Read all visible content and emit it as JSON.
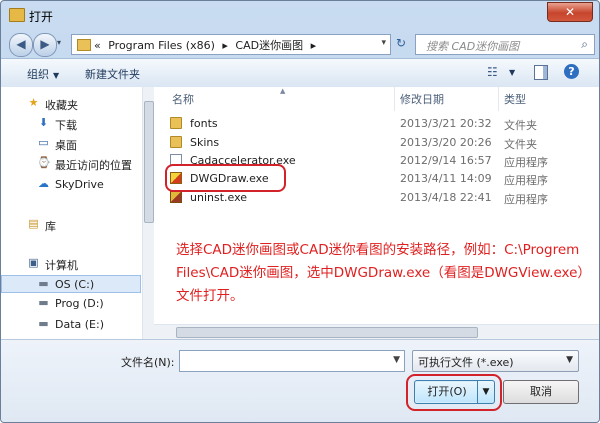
{
  "window": {
    "title": "打开",
    "close_glyph": "✕"
  },
  "address": {
    "back_glyph": "◀",
    "forward_glyph": "▶",
    "drop_glyph": "▾",
    "root_glyph": "«",
    "crumbs": [
      "Program Files (x86)",
      "▸",
      "CAD迷你画图",
      "▸"
    ],
    "refresh_glyph": "↻"
  },
  "search": {
    "placeholder": "搜索 CAD迷你画图",
    "icon": "search-icon",
    "glyph": "⌕"
  },
  "toolbar": {
    "organize": "组织",
    "new_folder": "新建文件夹",
    "arrow": "▼",
    "view_glyph": "☷",
    "help": "?"
  },
  "sidebar": {
    "items": [
      {
        "label": "收藏夹",
        "glyph": "★",
        "icon": "star-icon"
      },
      {
        "label": "下载",
        "glyph": "⬇",
        "icon": "download-icon"
      },
      {
        "label": "桌面",
        "glyph": "▭",
        "icon": "desktop-icon"
      },
      {
        "label": "最近访问的位置",
        "glyph": "⌚",
        "icon": "recent-icon"
      },
      {
        "label": "SkyDrive",
        "glyph": "☁",
        "icon": "cloud-icon"
      },
      {
        "label": "库",
        "glyph": "▤",
        "icon": "library-icon"
      },
      {
        "label": "计算机",
        "glyph": "▣",
        "icon": "computer-icon"
      },
      {
        "label": "OS (C:)",
        "glyph": "▬",
        "icon": "drive-icon"
      },
      {
        "label": "Prog (D:)",
        "glyph": "▬",
        "icon": "drive-icon"
      },
      {
        "label": "Data (E:)",
        "glyph": "▬",
        "icon": "drive-icon"
      }
    ]
  },
  "columns": {
    "name": "名称",
    "date": "修改日期",
    "type": "类型",
    "sort_glyph": "▲"
  },
  "files": [
    {
      "name": "fonts",
      "date": "2013/3/21 20:32",
      "type": "文件夹",
      "icon": "folder-icon"
    },
    {
      "name": "Skins",
      "date": "2013/3/20 20:26",
      "type": "文件夹",
      "icon": "folder-icon"
    },
    {
      "name": "Cadaccelerator.exe",
      "date": "2012/9/14 16:57",
      "type": "应用程序",
      "icon": "exe-icon"
    },
    {
      "name": "DWGDraw.exe",
      "date": "2013/4/11 14:09",
      "type": "应用程序",
      "icon": "dwg-icon"
    },
    {
      "name": "uninst.exe",
      "date": "2013/4/18 22:41",
      "type": "应用程序",
      "icon": "uninstall-icon"
    }
  ],
  "annotation": "选择CAD迷你画图或CAD迷你看图的安装路径，例如：C:\\Progrem Files\\CAD迷你画图，选中DWGDraw.exe（看图是DWGView.exe）文件打开。",
  "bottom": {
    "filename_label": "文件名(N):",
    "filename_value": "",
    "filetype": "可执行文件 (*.exe)",
    "open": "打开(O)",
    "cancel": "取消",
    "drop_glyph": "▼"
  },
  "colors": {
    "highlight": "#d2222a",
    "annotation": "#e02020"
  }
}
